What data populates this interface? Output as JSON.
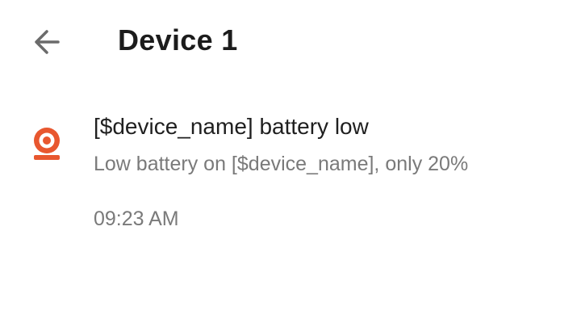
{
  "header": {
    "back_icon": "arrow-back-icon",
    "title": "Device 1"
  },
  "notification": {
    "icon": "camera-icon",
    "icon_color": "#e8572f",
    "title": "[$device_name] battery low",
    "body": "Low battery on [$device_name], only 20%",
    "time": "09:23 AM"
  }
}
